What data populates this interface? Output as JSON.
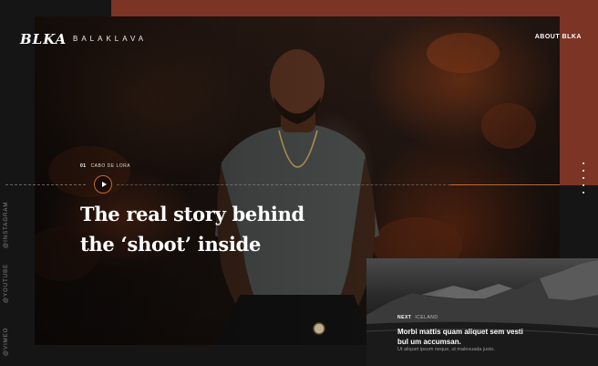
{
  "colors": {
    "accent": "#7c3424",
    "play_ring": "#c46a2a",
    "background": "#151515"
  },
  "header": {
    "logo": "BLKA",
    "brand": "BALAKLAVA",
    "about_link": "ABOUT BLKA"
  },
  "hero": {
    "slide_number": "01",
    "location": "CABO DE LORA",
    "headline": "The real story behind the ‘shoot’ inside",
    "play_icon": "play-icon"
  },
  "social": [
    "@VIMEO",
    "@YOUTUBE",
    "@INSTAGRAM"
  ],
  "next": {
    "label": "NEXT",
    "location": "ICELAND",
    "title": "Morbi mattis quam aliquet sem vesti bul um accumsan.",
    "subtitle": "Ut aliquet ipsum neque, ut malesuada justo."
  }
}
